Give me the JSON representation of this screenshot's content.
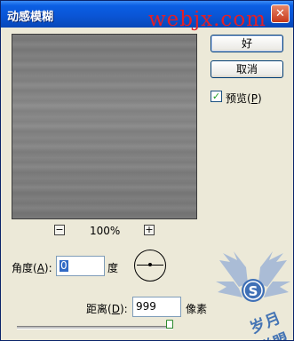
{
  "window": {
    "title": "动感模糊",
    "close_glyph": "✕"
  },
  "watermark": {
    "site": "webjx.com",
    "logo_text": "岁月联盟",
    "logo_letter": "S"
  },
  "buttons": {
    "ok_label": "好",
    "cancel_label": "取消"
  },
  "preview_option": {
    "label": "预览(P)",
    "checked": true,
    "check_glyph": "✓"
  },
  "zoom": {
    "minus_glyph": "−",
    "plus_glyph": "+",
    "level": "100%"
  },
  "angle": {
    "label": "角度(A):",
    "value": "0",
    "unit": "度"
  },
  "distance": {
    "label": "距离(D):",
    "value": "999",
    "unit": "像素",
    "slider_fraction": 1.0
  },
  "colors": {
    "titlebar": "#0a55d6",
    "dialog_bg": "#ece9d8",
    "watermark_red": "#e31f27",
    "logo_blue": "#4474b4"
  }
}
